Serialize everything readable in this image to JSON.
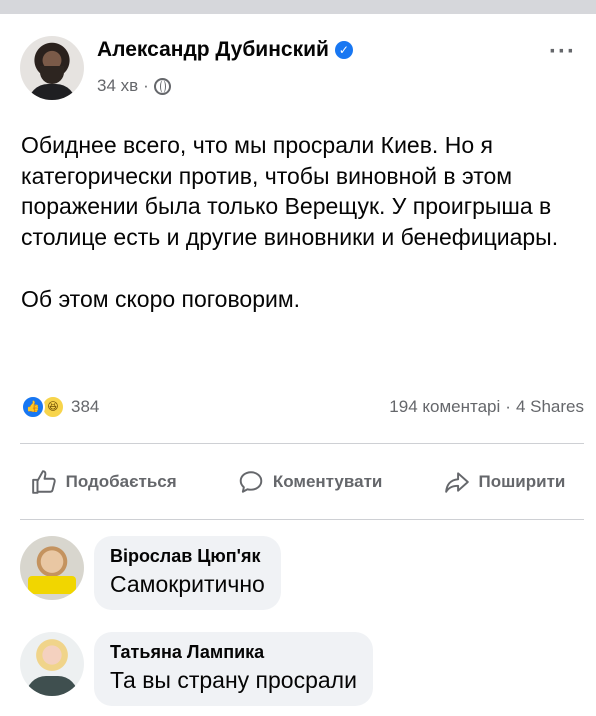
{
  "post": {
    "author": "Александр Дубинский",
    "time": "34 хв",
    "separator": "·",
    "more": "···",
    "paragraph1": "Обиднее всего, что мы просрали Киев. Но я категорически против, чтобы виновной в этом поражении была только Верещук. У проигрыша в столице есть и другие виновники и бенефициары.",
    "paragraph2": "Об этом скоро поговорим."
  },
  "stats": {
    "reactions": "384",
    "comments": "194 коментарі",
    "dot": "·",
    "shares": "4 Shares"
  },
  "actions": {
    "like": "Подобається",
    "comment": "Коментувати",
    "share": "Поширити"
  },
  "comments": [
    {
      "name": "Вірослав Цюп'як",
      "text": "Самокритично"
    },
    {
      "name": "Татьяна Лампика",
      "text": "Та вы страну просрали"
    }
  ],
  "colors": {
    "accent": "#1877f2",
    "muted": "#65676b",
    "bubble": "#f0f2f5"
  }
}
